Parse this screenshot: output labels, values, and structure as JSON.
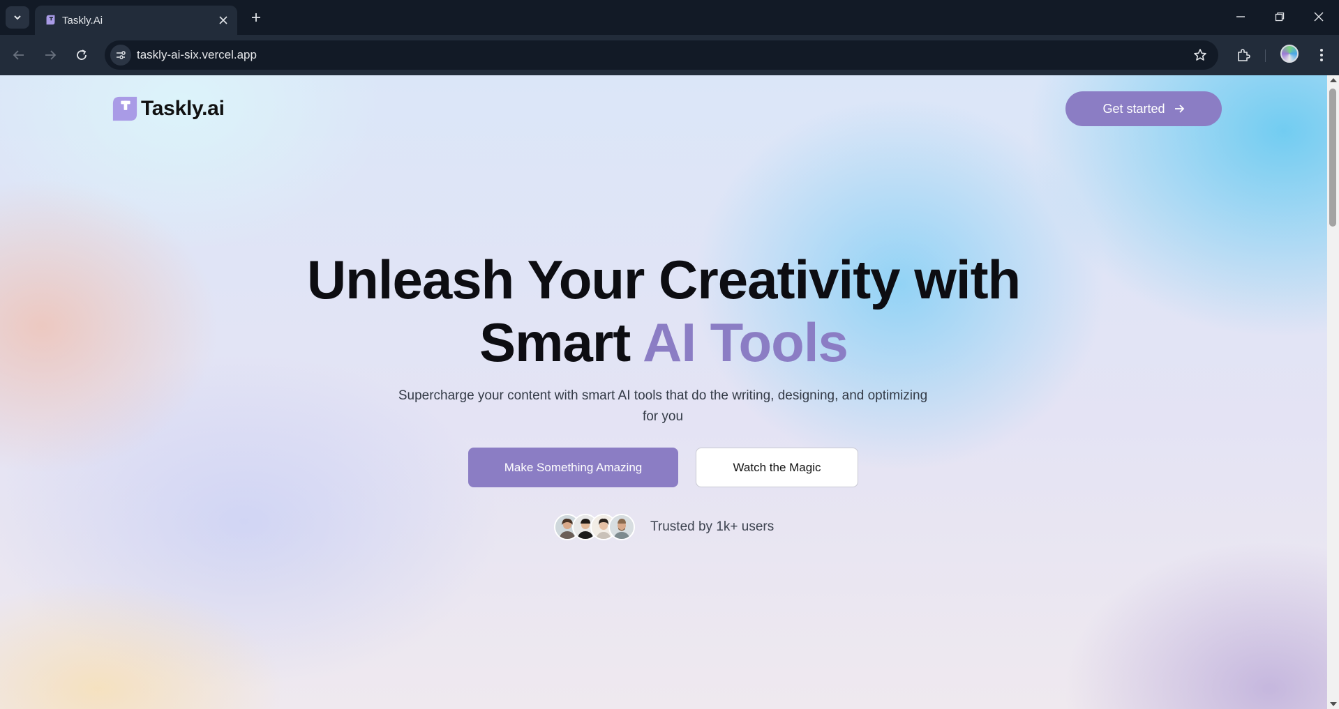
{
  "browser": {
    "tab_title": "Taskly.Ai",
    "url": "taskly-ai-six.vercel.app"
  },
  "page": {
    "brand": "Taskly.ai",
    "nav_cta": "Get started",
    "hero": {
      "line1": "Unleash Your Creativity with",
      "line2_plain": "Smart ",
      "line2_accent": "AI Tools",
      "subtitle": "Supercharge your content with smart AI tools that do the writing, designing, and optimizing for you"
    },
    "primary_button": "Make Something Amazing",
    "secondary_button": "Watch the Magic",
    "trusted_text": "Trusted by 1k+ users",
    "avatars": [
      "user-avatar-1",
      "user-avatar-2",
      "user-avatar-3",
      "user-avatar-4"
    ]
  },
  "colors": {
    "accent": "#8b7dc4",
    "chrome_dark": "#121a26",
    "chrome_toolbar": "#222c3a"
  }
}
